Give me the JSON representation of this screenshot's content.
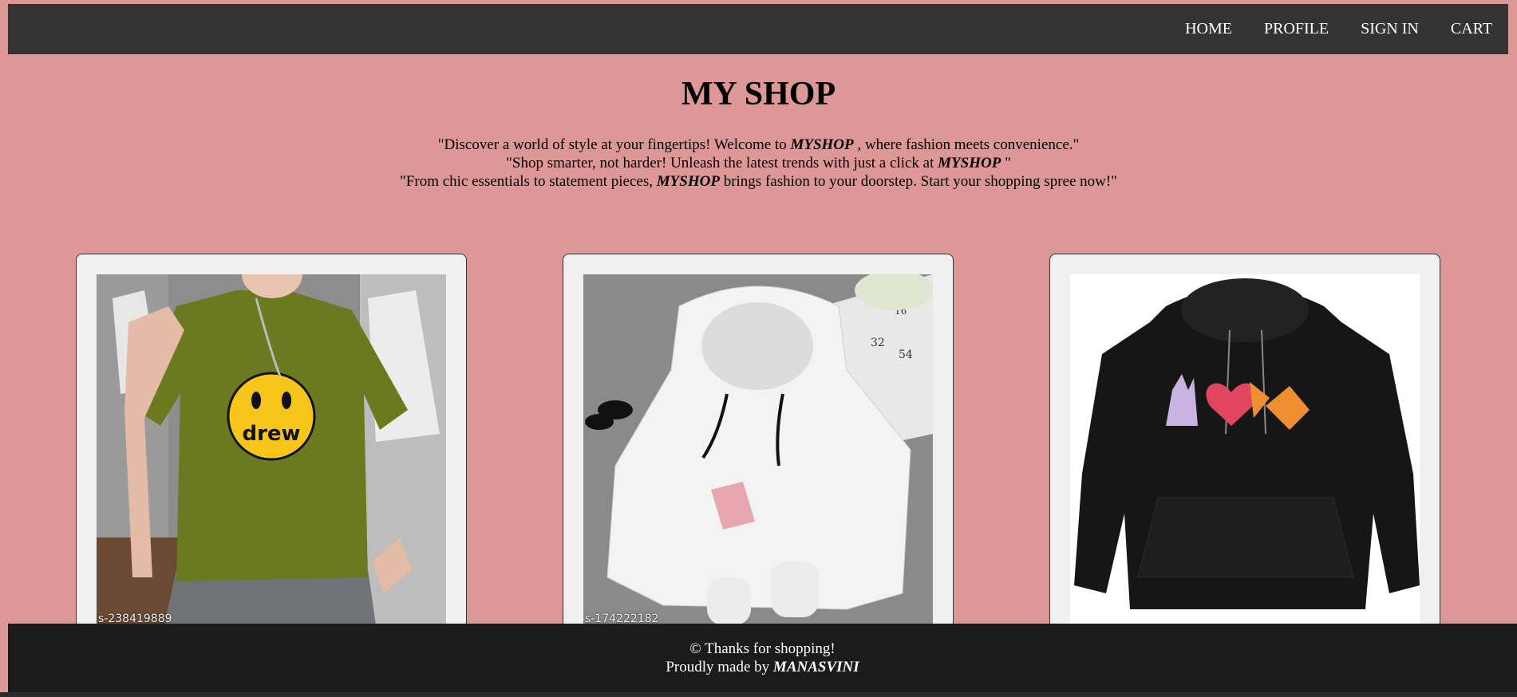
{
  "nav": {
    "items": [
      {
        "label": "HOME"
      },
      {
        "label": "PROFILE"
      },
      {
        "label": "SIGN IN"
      },
      {
        "label": "CART"
      }
    ]
  },
  "hero": {
    "title": "MY SHOP",
    "line1_pre": "\"Discover a world of style at your fingertips! Welcome to ",
    "line1_brand": "MYSHOP",
    "line1_post": " , where fashion meets convenience.\"",
    "line2_pre": "\"Shop smarter, not harder! Unleash the latest trends with just a click at ",
    "line2_brand": "MYSHOP",
    "line2_post": " \"",
    "line3_pre": "\"From chic essentials to statement pieces, ",
    "line3_brand": "MYSHOP",
    "line3_post": " brings fashion to your doorstep. Start your shopping spree now!\""
  },
  "products": [
    {
      "image": "green-smiley-tshirt-image",
      "code": "s-238419889",
      "print_text": "drew"
    },
    {
      "image": "white-crop-hoodie-image",
      "code": "s-174222182",
      "page_numbers": [
        "32",
        "54",
        "16"
      ]
    },
    {
      "image": "black-hoodie-peace-heart-butterfly-image"
    }
  ],
  "footer": {
    "line1": "© Thanks for shopping!",
    "line2_pre": "Proudly made by ",
    "line2_name": "MANASVINI"
  },
  "colors": {
    "page_bg": "#dd9797",
    "navbar_bg": "#333333",
    "footer_bg": "#1b1b1c",
    "card_bg": "#f0f0f0"
  }
}
